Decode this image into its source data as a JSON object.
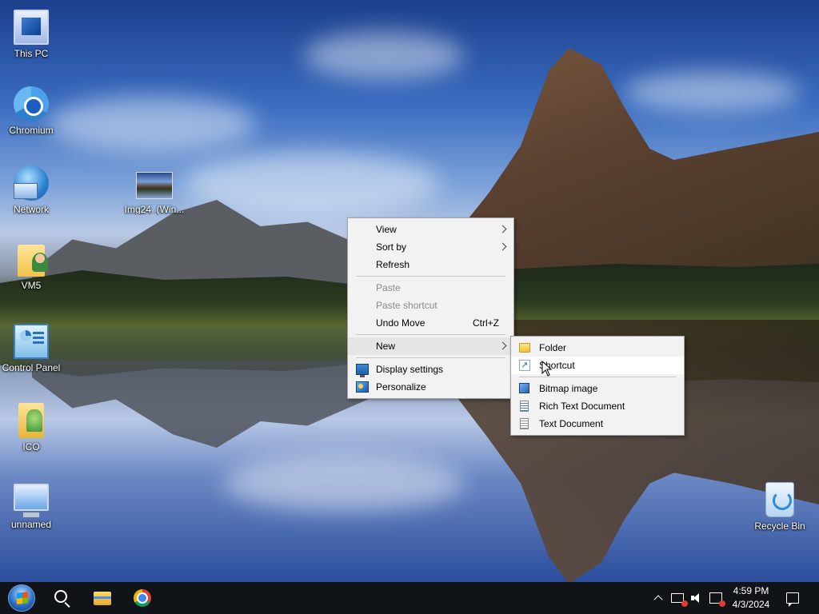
{
  "desktop": {
    "icons": [
      {
        "label": "This PC",
        "icon": "computer-icon"
      },
      {
        "label": "Chromium",
        "icon": "chromium-icon"
      },
      {
        "label": "Network",
        "icon": "network-icon"
      },
      {
        "label": "VM5",
        "icon": "user-folder-icon"
      },
      {
        "label": "Control Panel",
        "icon": "control-panel-icon"
      },
      {
        "label": "ICO",
        "icon": "folder-icon"
      },
      {
        "label": "unnamed",
        "icon": "monitor-icon"
      },
      {
        "label": "Img24_(Win...",
        "icon": "image-file-icon"
      },
      {
        "label": "Recycle Bin",
        "icon": "recycle-bin-icon"
      }
    ]
  },
  "context_menu": {
    "items": [
      {
        "label": "View",
        "submenu": true
      },
      {
        "label": "Sort by",
        "submenu": true
      },
      {
        "label": "Refresh"
      },
      {
        "label": "Paste",
        "disabled": true
      },
      {
        "label": "Paste shortcut",
        "disabled": true
      },
      {
        "label": "Undo Move",
        "shortcut": "Ctrl+Z"
      },
      {
        "label": "New",
        "submenu": true,
        "highlighted": true
      },
      {
        "label": "Display settings",
        "icon": "display-icon"
      },
      {
        "label": "Personalize",
        "icon": "personalize-icon"
      }
    ]
  },
  "new_submenu": {
    "items": [
      {
        "label": "Folder",
        "icon": "folder-icon"
      },
      {
        "label": "Shortcut",
        "icon": "shortcut-icon",
        "highlighted": true
      },
      {
        "label": "Bitmap image",
        "icon": "bitmap-icon"
      },
      {
        "label": "Rich Text Document",
        "icon": "rich-text-icon"
      },
      {
        "label": "Text Document",
        "icon": "text-document-icon"
      }
    ]
  },
  "taskbar": {
    "pinned": [
      "start-icon",
      "search-icon",
      "file-explorer-icon",
      "chrome-icon"
    ],
    "clock": {
      "time": "4:59 PM",
      "date": "4/3/2024"
    }
  },
  "colors": {
    "taskbar_bg": "#101418",
    "menu_bg": "#f2f2f2",
    "menu_hover": "#e5e5e5",
    "disabled_text": "#8a8a8a"
  }
}
